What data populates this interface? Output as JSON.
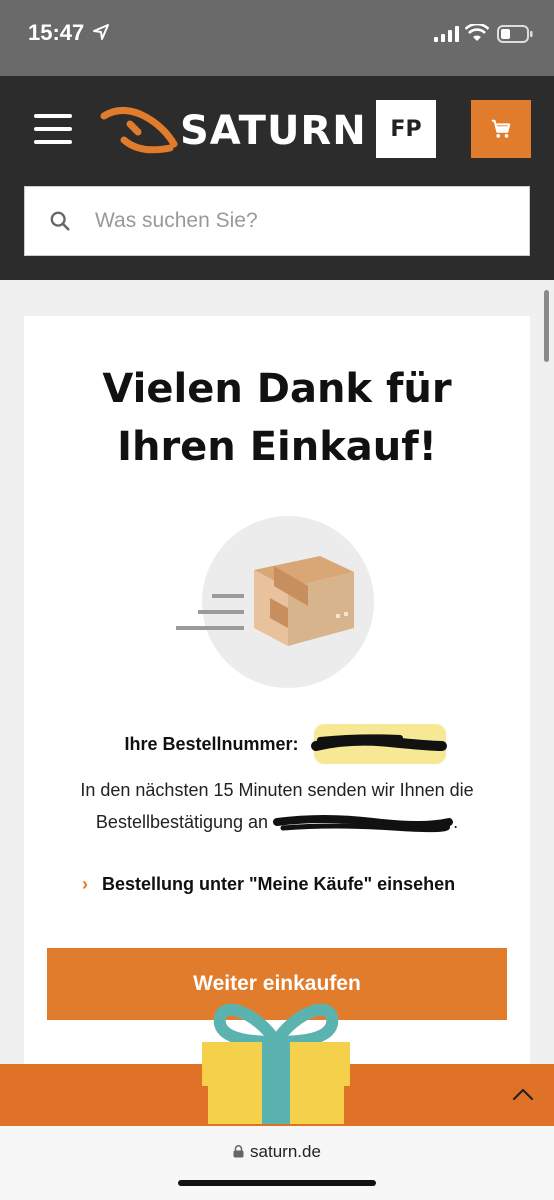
{
  "status_bar": {
    "time": "15:47"
  },
  "header": {
    "logo_text": "SATURN",
    "profile_initials": "FP",
    "search": {
      "placeholder": "Was suchen Sie?"
    }
  },
  "confirmation": {
    "title_line1": "Vielen Dank für",
    "title_line2": "Ihren Einkauf!",
    "order_label": "Ihre Bestellnummer:",
    "info_text_before": "In den nächsten 15 Minuten senden wir Ihnen die Bestellbestätigung an",
    "info_text_after": ".",
    "my_purchases_link": "Bestellung unter \"Meine Käufe\" einsehen",
    "continue_button": "Weiter einkaufen"
  },
  "browser": {
    "url": "saturn.de"
  },
  "colors": {
    "brand_orange": "#e07c2b",
    "header_dark": "#2c2c2c",
    "promo_orange": "#e07228"
  },
  "icons": {
    "menu": "hamburger-icon",
    "cart": "shopping-cart-icon",
    "search": "search-icon",
    "package": "package-icon",
    "gift": "gift-icon",
    "chevron_up": "chevron-up-icon",
    "lock": "lock-icon"
  }
}
